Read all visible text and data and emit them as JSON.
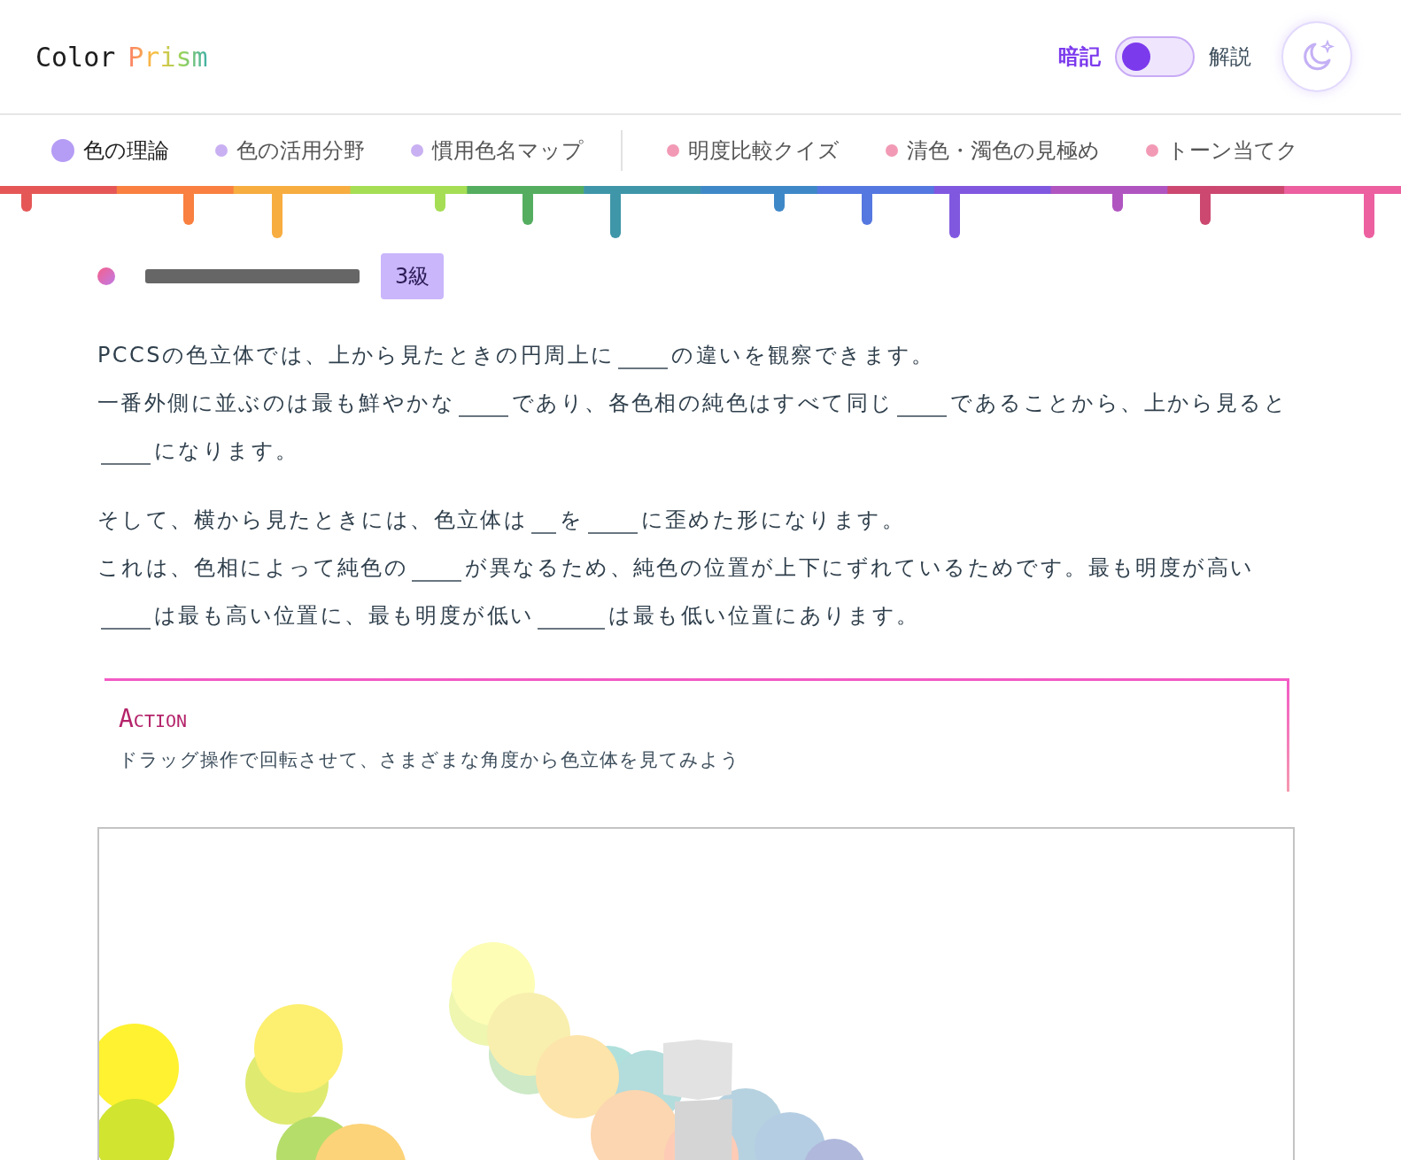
{
  "logo": {
    "first": "Color",
    "second": "Prism"
  },
  "mode": {
    "options": [
      {
        "text": "暗記",
        "selected": true
      },
      {
        "text": "解説",
        "selected": false
      }
    ]
  },
  "tab_groups": [
    [
      {
        "label": "色の理論",
        "selected": true,
        "color": "#b59cf5"
      },
      {
        "label": "色の活用分野",
        "selected": false,
        "color": "#c9b0f2"
      },
      {
        "label": "慣用色名マップ",
        "selected": false,
        "color": "#c9b0f2"
      }
    ],
    [
      {
        "label": "明度比較クイズ",
        "selected": false,
        "color": "#f29ab5"
      },
      {
        "label": "清色・濁色の見極め",
        "selected": false,
        "color": "#f29ab5"
      },
      {
        "label": "トーン当てク",
        "selected": false,
        "color": "#f29ab5"
      }
    ]
  ],
  "section": {
    "badge": "3級"
  },
  "paragraphs": [
    [
      [
        {
          "kind": "text",
          "text": "PCCSの色立体では、上から見たときの円周上に"
        },
        {
          "kind": "blank"
        },
        {
          "kind": "text",
          "text": "の違いを観察できます。"
        }
      ],
      [
        {
          "kind": "text",
          "text": "一番外側に並ぶのは最も鮮やかな"
        },
        {
          "kind": "blank"
        },
        {
          "kind": "text",
          "text": "であり、各色相の純色はすべて同じ"
        },
        {
          "kind": "blank"
        },
        {
          "kind": "text",
          "text": "であることから、上から見ると"
        },
        {
          "kind": "blank"
        },
        {
          "kind": "text",
          "text": "になります。"
        }
      ]
    ],
    [
      [
        {
          "kind": "text",
          "text": "そして、横から見たときには、色立体は"
        },
        {
          "kind": "short_blank"
        },
        {
          "kind": "text",
          "text": "を"
        },
        {
          "kind": "blank"
        },
        {
          "kind": "text",
          "text": "に歪めた形になります。"
        }
      ],
      [
        {
          "kind": "text",
          "text": "これは、色相によって純色の"
        },
        {
          "kind": "blank"
        },
        {
          "kind": "text",
          "text": "が異なるため、純色の位置が上下にずれているためです。最も明度が高い"
        },
        {
          "kind": "blank"
        },
        {
          "kind": "text",
          "text": "は最も高い位置に、最も明度が低い"
        },
        {
          "kind": "long_blank"
        },
        {
          "kind": "text",
          "text": "は最も低い位置にあります。"
        }
      ]
    ]
  ],
  "action": {
    "title": "Action",
    "text": "ドラッグ操作で回転させて、さまざまな角度から色立体を見てみよう"
  },
  "viewer": {
    "kind": "picture"
  }
}
